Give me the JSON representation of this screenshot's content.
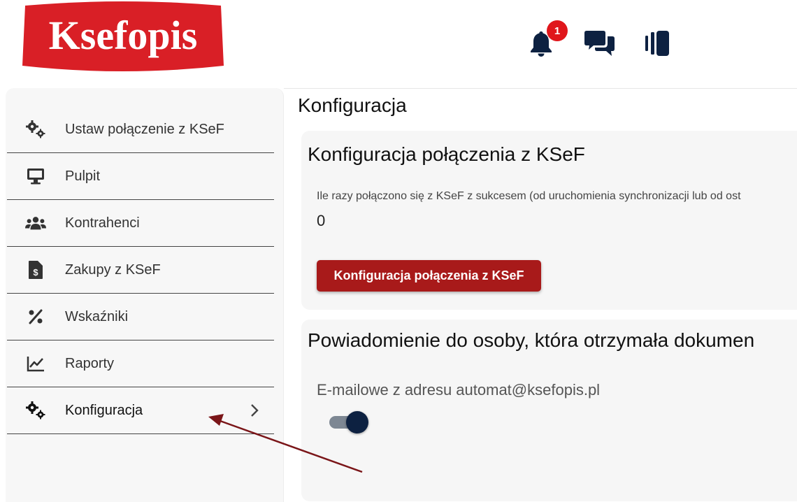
{
  "app": {
    "logo_text": "Ksefopis",
    "brand_color": "#d91f26"
  },
  "header": {
    "notifications": {
      "icon": "bell-icon",
      "badge_count": "1"
    },
    "messages": {
      "icon": "chat-icon"
    },
    "panel_toggle": {
      "icon": "panel-icon"
    }
  },
  "sidebar": {
    "items": [
      {
        "label": "Ustaw połączenie z KSeF",
        "icon": "gears-icon"
      },
      {
        "label": "Pulpit",
        "icon": "monitor-icon"
      },
      {
        "label": "Kontrahenci",
        "icon": "users-icon"
      },
      {
        "label": "Zakupy z KSeF",
        "icon": "invoice-icon"
      },
      {
        "label": "Wskaźniki",
        "icon": "percent-icon"
      },
      {
        "label": "Raporty",
        "icon": "chart-icon"
      },
      {
        "label": "Konfiguracja",
        "icon": "gears-icon",
        "active": true
      }
    ]
  },
  "main": {
    "title": "Konfiguracja",
    "connection_card": {
      "title": "Konfiguracja połączenia z KSeF",
      "stat_label": "Ile razy połączono się z KSeF z sukcesem (od uruchomienia synchronizacji lub od ost",
      "stat_value": "0",
      "button_label": "Konfiguracja połączenia z KSeF"
    },
    "notification_card": {
      "title": "Powiadomienie do osoby, która otrzymała dokumen",
      "email_label": "E-mailowe z adresu automat@ksefopis.pl",
      "toggle_on": true
    }
  },
  "colors": {
    "accent": "#a81a1a",
    "toggle_knob": "#0d2141",
    "arrow": "#7a1518"
  }
}
